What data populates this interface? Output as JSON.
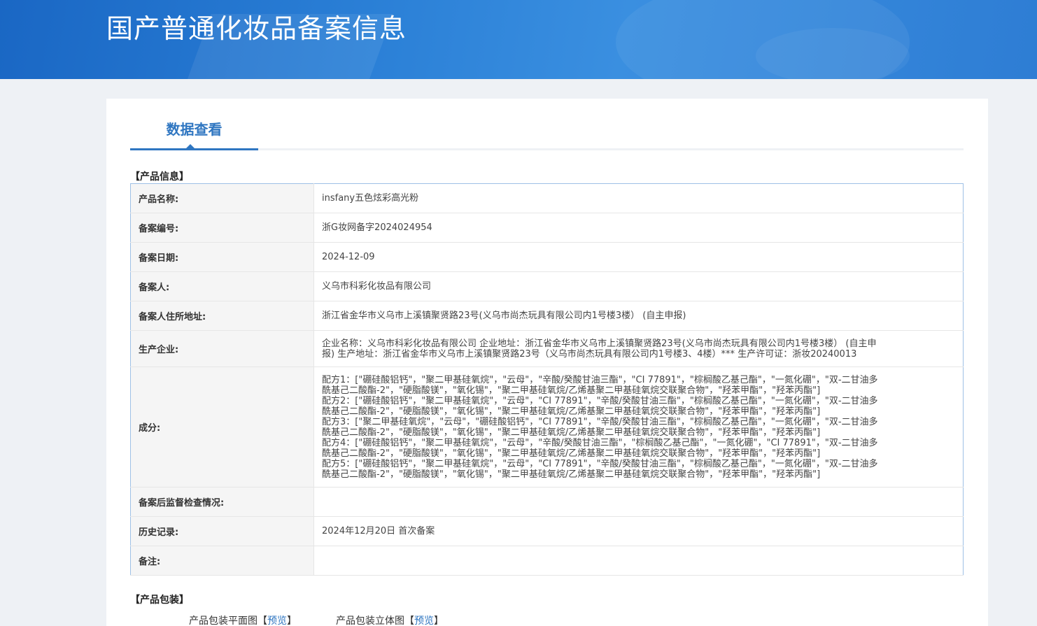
{
  "header": {
    "title": "国产普通化妆品备案信息"
  },
  "tabs": [
    {
      "label": "数据查看"
    }
  ],
  "product_info": {
    "section_title": "【产品信息】",
    "rows": [
      {
        "label": "产品名称:",
        "value": "insfany五色炫彩高光粉"
      },
      {
        "label": "备案编号:",
        "value": "浙G妆网备字2024024954"
      },
      {
        "label": "备案日期:",
        "value": "2024-12-09"
      },
      {
        "label": "备案人:",
        "value": "义乌市科彩化妆品有限公司"
      },
      {
        "label": "备案人住所地址:",
        "value": "浙江省金华市义乌市上溪镇聚贤路23号(义乌市尚杰玩具有限公司内1号楼3楼） (自主申报)"
      },
      {
        "label": "生产企业:",
        "lines": [
          "企业名称：义乌市科彩化妆品有限公司 企业地址：浙江省金华市义乌市上溪镇聚贤路23号(义乌市尚杰玩具有限公司内1号楼3楼） (自主申",
          "报) 生产地址：浙江省金华市义乌市上溪镇聚贤路23号（义乌市尚杰玩具有限公司内1号楼3、4楼）*** 生产许可证：浙妆20240013"
        ]
      },
      {
        "label": "成分:",
        "lines": [
          "配方1：[\"硼硅酸铝钙\"，\"聚二甲基硅氧烷\"，\"云母\"，\"辛酸/癸酸甘油三酯\"，\"CI 77891\"，\"棕榈酸乙基己酯\"，\"一氮化硼\"，\"双-二甘油多",
          "酰基己二酸酯-2\"，\"硬脂酸镁\"，\"氧化锡\"，\"聚二甲基硅氧烷/乙烯基聚二甲基硅氧烷交联聚合物\"，\"羟苯甲酯\"，\"羟苯丙酯\"]",
          "配方2：[\"硼硅酸铝钙\"，\"聚二甲基硅氧烷\"，\"云母\"，\"CI 77891\"，\"辛酸/癸酸甘油三酯\"，\"棕榈酸乙基己酯\"，\"一氮化硼\"，\"双-二甘油多",
          "酰基己二酸酯-2\"，\"硬脂酸镁\"，\"氧化锡\"，\"聚二甲基硅氧烷/乙烯基聚二甲基硅氧烷交联聚合物\"，\"羟苯甲酯\"，\"羟苯丙酯\"]",
          "配方3：[\"聚二甲基硅氧烷\"，\"云母\"，\"硼硅酸铝钙\"，\"CI 77891\"，\"辛酸/癸酸甘油三酯\"，\"棕榈酸乙基己酯\"，\"一氮化硼\"，\"双-二甘油多",
          "酰基己二酸酯-2\"，\"硬脂酸镁\"，\"氧化锡\"，\"聚二甲基硅氧烷/乙烯基聚二甲基硅氧烷交联聚合物\"，\"羟苯甲酯\"，\"羟苯丙酯\"]",
          "配方4：[\"硼硅酸铝钙\"，\"聚二甲基硅氧烷\"，\"云母\"，\"辛酸/癸酸甘油三酯\"，\"棕榈酸乙基己酯\"，\"一氮化硼\"，\"CI 77891\"，\"双-二甘油多",
          "酰基己二酸酯-2\"，\"硬脂酸镁\"，\"氧化锡\"，\"聚二甲基硅氧烷/乙烯基聚二甲基硅氧烷交联聚合物\"，\"羟苯甲酯\"，\"羟苯丙酯\"]",
          "配方5：[\"硼硅酸铝钙\"，\"聚二甲基硅氧烷\"，\"云母\"，\"CI 77891\"，\"辛酸/癸酸甘油三酯\"，\"棕榈酸乙基己酯\"，\"一氮化硼\"，\"双-二甘油多",
          "酰基己二酸酯-2\"，\"硬脂酸镁\"，\"氧化锡\"，\"聚二甲基硅氧烷/乙烯基聚二甲基硅氧烷交联聚合物\"，\"羟苯甲酯\"，\"羟苯丙酯\"]"
        ]
      },
      {
        "label": "备案后监督检查情况:",
        "value": ""
      },
      {
        "label": "历史记录:",
        "value": "2024年12月20日 首次备案"
      },
      {
        "label": "备注:",
        "value": ""
      }
    ]
  },
  "packaging": {
    "section_title": "【产品包装】",
    "items": [
      {
        "label": "产品包装平面图",
        "bracket_open": "【",
        "link": "预览",
        "bracket_close": "】"
      },
      {
        "label": "产品包装立体图",
        "bracket_open": "【",
        "link": "预览",
        "bracket_close": "】"
      }
    ]
  }
}
